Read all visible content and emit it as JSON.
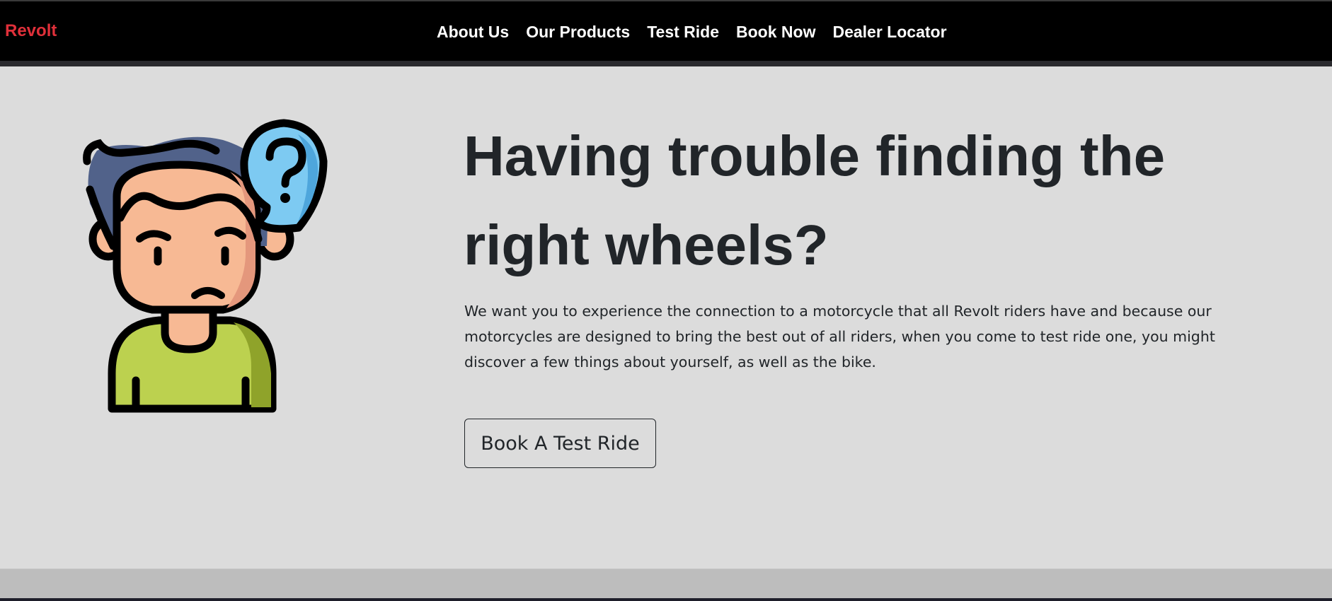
{
  "navbar": {
    "brand": "Revolt",
    "links": [
      "About Us",
      "Our Products",
      "Test Ride",
      "Book Now",
      "Dealer Locator"
    ]
  },
  "hero": {
    "illustration_icon": "confused-person-question-icon",
    "headline": "Having trouble finding the right wheels?",
    "description": "We want you to experience the connection to a motorcycle that all Revolt riders have and because our motorcycles are designed to bring the best out of all riders, when you come to test ride one, you might discover a few things about yourself, as well as the bike.",
    "cta_label": "Book A Test Ride"
  },
  "colors": {
    "brand": "#e0303a",
    "navbar_bg": "#000000",
    "hero_bg": "#dcdcdc",
    "text": "#212529",
    "hair": "#51628a",
    "skin": "#f7b994",
    "skin_shadow": "#e4977c",
    "shirt": "#bcd14f",
    "shirt_shadow": "#8fa32a",
    "bubble": "#7dcaf2",
    "bubble_shadow": "#4ea6dc"
  }
}
